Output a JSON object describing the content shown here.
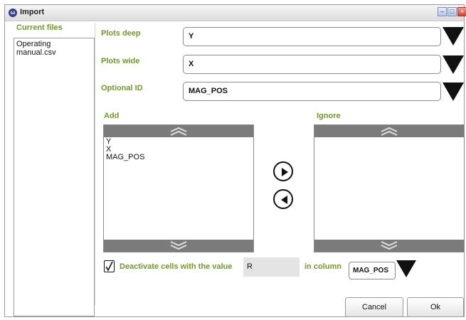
{
  "window": {
    "title": "Import",
    "app_icon_letter": "ω"
  },
  "sidebar": {
    "label": "Current files",
    "files": [
      "Operating manual.csv"
    ]
  },
  "fields": [
    {
      "label": "Plots deep",
      "value": "Y"
    },
    {
      "label": "Plots wide",
      "value": "X"
    },
    {
      "label": "Optional ID",
      "value": "MAG_POS"
    }
  ],
  "add": {
    "label": "Add",
    "items": [
      "Y",
      "X",
      "MAG_POS"
    ]
  },
  "ignore": {
    "label": "Ignore",
    "items": []
  },
  "deactivate": {
    "checked": true,
    "label": "Deactivate cells with the value",
    "value": "R",
    "column_label": "in column",
    "column_value": "MAG_POS"
  },
  "buttons": {
    "cancel": "Cancel",
    "ok": "Ok"
  },
  "icons": {
    "move_right": "arrow-right-circle-icon",
    "move_left": "arrow-left-circle-icon",
    "dropdown": "triangle-down-icon",
    "scroll_up": "double-chevron-up-icon",
    "scroll_down": "double-chevron-down-icon",
    "check": "check-icon"
  },
  "colors": {
    "label_green": "#6f9a2a",
    "scrollbar": "#7b7b7b"
  }
}
